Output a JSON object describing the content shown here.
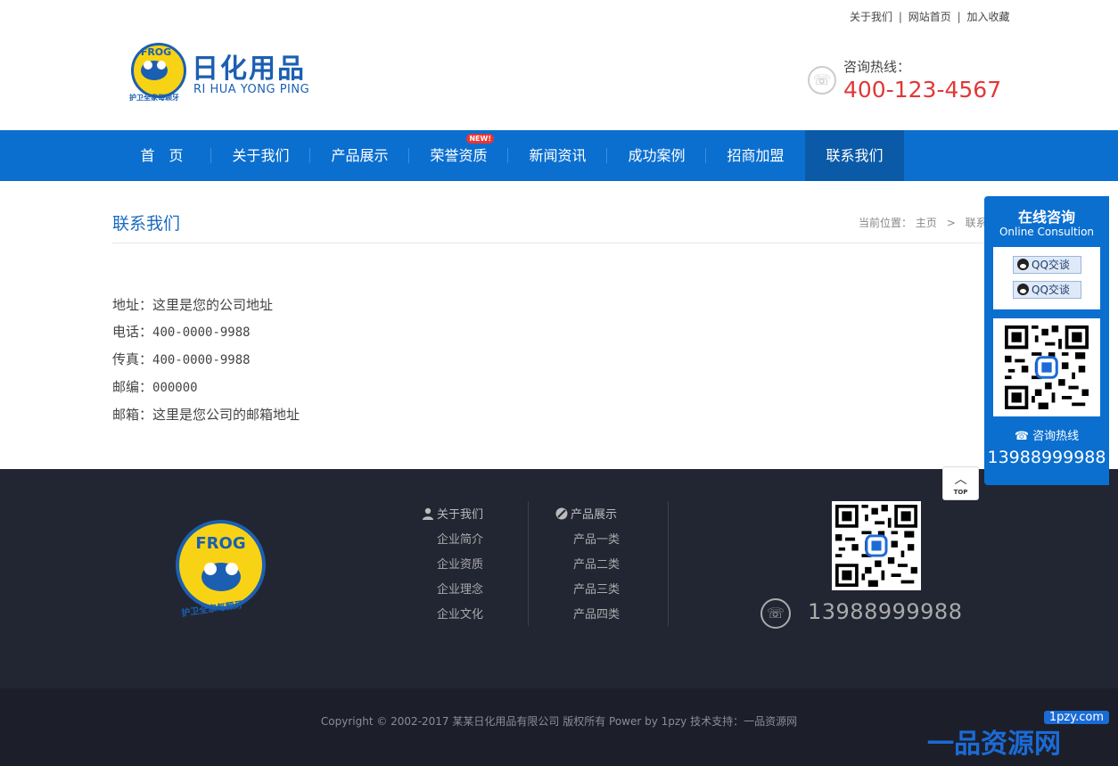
{
  "top_links": [
    "关于我们",
    "网站首页",
    "加入收藏"
  ],
  "logo": {
    "cn": "日化用品",
    "en": "RI HUA YONG PING",
    "badge": "FROG",
    "slogan": "护卫全家每颗牙"
  },
  "hotline": {
    "label": "咨询热线：",
    "number": "400-123-4567"
  },
  "nav": [
    {
      "label": "首　页"
    },
    {
      "label": "关于我们"
    },
    {
      "label": "产品展示"
    },
    {
      "label": "荣誉资质",
      "badge": "NEW!"
    },
    {
      "label": "新闻资讯"
    },
    {
      "label": "成功案例"
    },
    {
      "label": "招商加盟"
    },
    {
      "label": "联系我们",
      "active": true
    }
  ],
  "page": {
    "title": "联系我们",
    "breadcrumb": {
      "prefix": "当前位置：",
      "home": "主页",
      "sep": ">",
      "current": "联系我们"
    }
  },
  "contact": [
    {
      "label": "地址：",
      "value": "这里是您的公司地址"
    },
    {
      "label": "电话：",
      "value": "400-0000-9988"
    },
    {
      "label": "传真：",
      "value": "400-0000-9988"
    },
    {
      "label": "邮编：",
      "value": "000000"
    },
    {
      "label": "邮箱：",
      "value": "这里是您公司的邮箱地址"
    }
  ],
  "footer": {
    "col1": {
      "head": "关于我们",
      "items": [
        "企业简介",
        "企业资质",
        "企业理念",
        "企业文化"
      ]
    },
    "col2": {
      "head": "产品展示",
      "items": [
        "产品一类",
        "产品二类",
        "产品三类",
        "产品四类"
      ]
    },
    "phone": "13988999988",
    "copyright": "Copyright © 2002-2017 某某日化用品有限公司 版权所有 Power by 1pzy 技术支持：一品资源网"
  },
  "float_panel": {
    "title": "在线咨询",
    "subtitle": "Online Consultion",
    "qq_buttons": [
      "QQ交谈",
      "QQ交谈"
    ],
    "hotline_label": "咨询热线",
    "hotline_number": "13988999988"
  },
  "top_button": "TOP",
  "watermark": {
    "big": "一品资源网",
    "url": "1pzy.com"
  },
  "colors": {
    "brand_blue": "#0b6fd0",
    "accent_red": "#e03838",
    "footer_bg": "#222633"
  }
}
